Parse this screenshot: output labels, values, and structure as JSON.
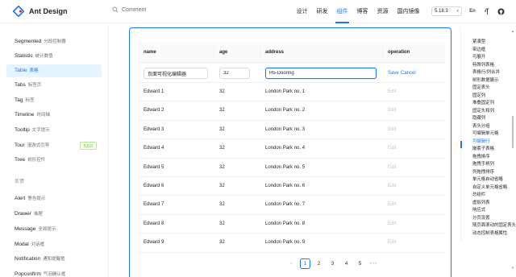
{
  "header": {
    "logo_text": "Ant Design",
    "search_placeholder": "Comment",
    "nav": [
      "设计",
      "研发",
      "组件",
      "博客",
      "资源",
      "国内镜像"
    ],
    "active_nav": 2,
    "version": "5.18.3",
    "lang_icon_text": "En",
    "accent": "#1677ff"
  },
  "sidebar": {
    "items": [
      {
        "en": "Segmented",
        "cn": "分段控制器"
      },
      {
        "en": "Statistic",
        "cn": "统计数值"
      },
      {
        "en": "Table",
        "cn": "表格",
        "active": true
      },
      {
        "en": "Tabs",
        "cn": "标签页"
      },
      {
        "en": "Tag",
        "cn": "标签"
      },
      {
        "en": "Timeline",
        "cn": "时间轴"
      },
      {
        "en": "Tooltip",
        "cn": "文字提示"
      },
      {
        "en": "Tour",
        "cn": "漫游式引导",
        "badge": "5.0.0"
      },
      {
        "en": "Tree",
        "cn": "树形控件"
      }
    ],
    "group_label": "反馈",
    "group_items": [
      {
        "en": "Alert",
        "cn": "警告提示"
      },
      {
        "en": "Drawer",
        "cn": "抽屉"
      },
      {
        "en": "Message",
        "cn": "全局提示"
      },
      {
        "en": "Modal",
        "cn": "对话框"
      },
      {
        "en": "Notification",
        "cn": "通知提醒框"
      },
      {
        "en": "Popconfirm",
        "cn": "气泡确认框"
      }
    ]
  },
  "table": {
    "columns": [
      "name",
      "age",
      "address",
      "operation"
    ],
    "editing": {
      "name": "页面可视化编辑器",
      "age": "32",
      "address": "H5-Dooring",
      "save": "Save",
      "cancel": "Cancel"
    },
    "rows": [
      {
        "name": "Edward 1",
        "age": "32",
        "address": "London Park no. 1",
        "op": "Edit"
      },
      {
        "name": "Edward 2",
        "age": "32",
        "address": "London Park no. 2",
        "op": "Edit"
      },
      {
        "name": "Edward 3",
        "age": "32",
        "address": "London Park no. 3",
        "op": "Edit"
      },
      {
        "name": "Edward 4",
        "age": "32",
        "address": "London Park no. 4",
        "op": "Edit"
      },
      {
        "name": "Edward 5",
        "age": "32",
        "address": "London Park no. 5",
        "op": "Edit"
      },
      {
        "name": "Edward 6",
        "age": "32",
        "address": "London Park no. 6",
        "op": "Edit"
      },
      {
        "name": "Edward 7",
        "age": "32",
        "address": "London Park no. 7",
        "op": "Edit"
      },
      {
        "name": "Edward 8",
        "age": "32",
        "address": "London Park no. 8",
        "op": "Edit"
      },
      {
        "name": "Edward 9",
        "age": "32",
        "address": "London Park no. 9",
        "op": "Edit"
      }
    ],
    "pagination": {
      "prev": "<",
      "pages": [
        "1",
        "2",
        "3",
        "4",
        "5"
      ],
      "current": 1,
      "more": "•••"
    }
  },
  "anchor": {
    "items": [
      "紧凑型",
      "带边框",
      "可展开",
      "特殊列表格",
      "表格行/列合并",
      "树形数据展示",
      "固定表头",
      "固定列",
      "堆叠固定列",
      "固定头和列",
      "隐藏列",
      "表头分组",
      "可编辑单元格",
      "可编辑行",
      "嵌套子表格",
      "拖拽排序",
      "拖拽手柄列",
      "列拖拽排序",
      "单元格自动省略",
      "自定义单元格省略",
      "总结栏",
      "虚拟列表",
      "响应式",
      "分页设置",
      "随页面滚动的固定表头和滚动条",
      "动态控制表格属性"
    ],
    "active": 13
  }
}
